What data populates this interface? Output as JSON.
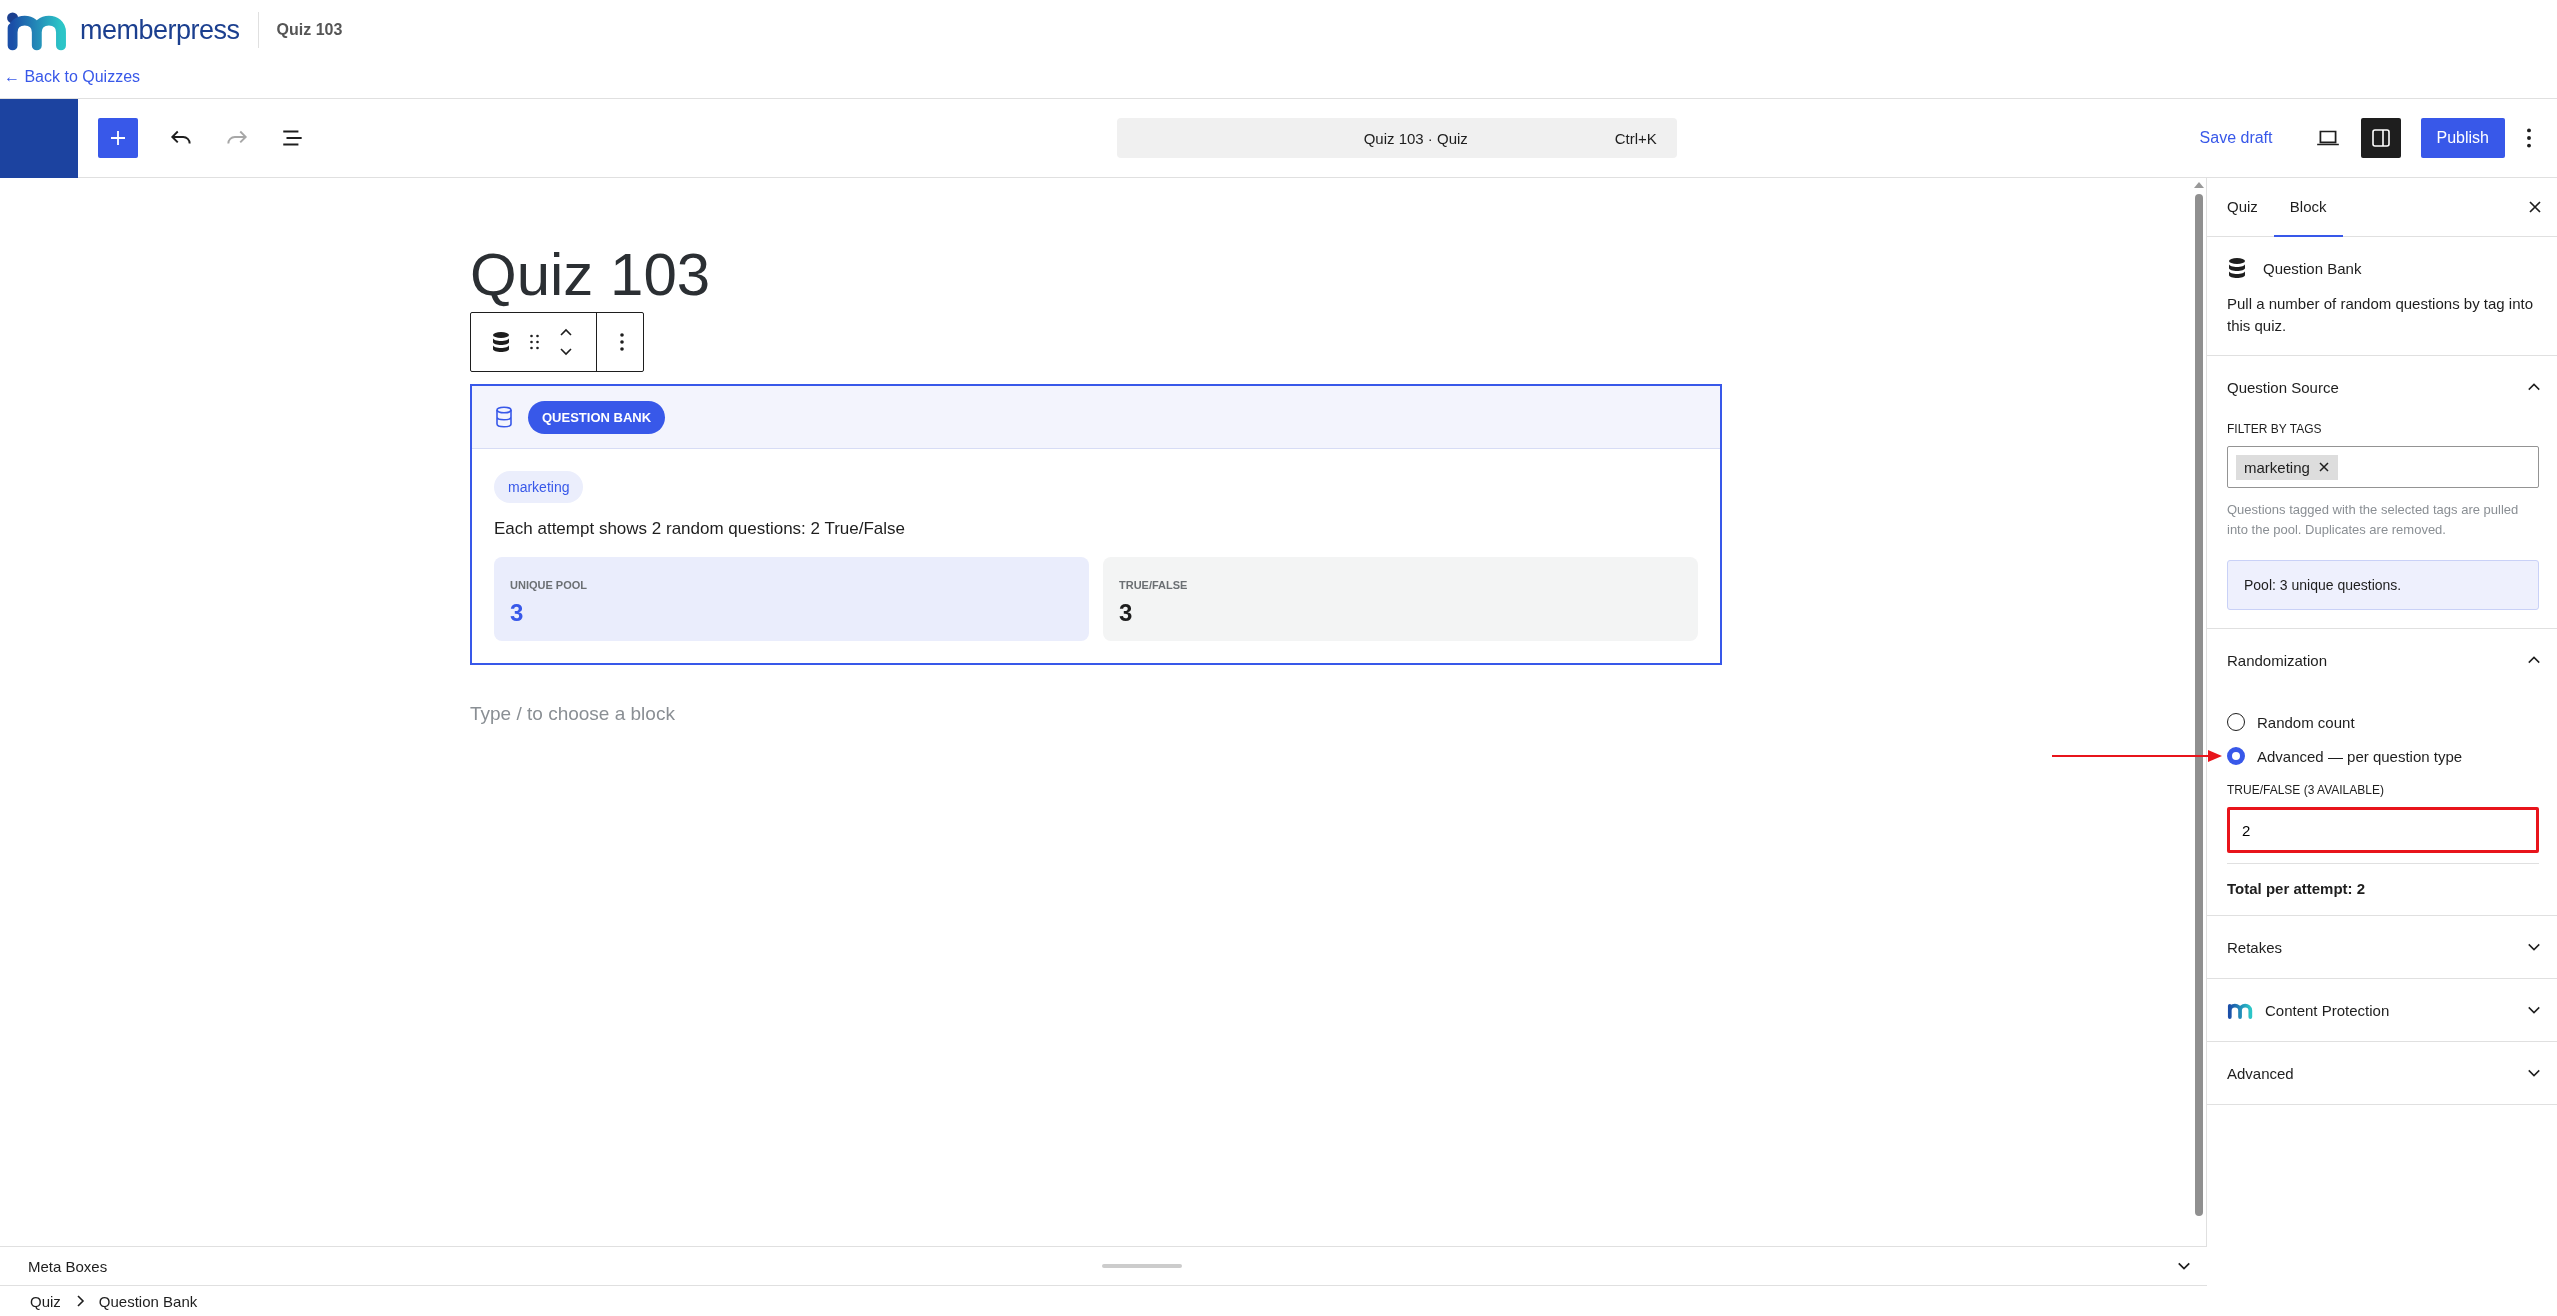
{
  "header": {
    "brand": "memberpress",
    "page_title": "Quiz 103",
    "back_link": "← Back to Quizzes"
  },
  "toolbar": {
    "command_title": "Quiz 103 · Quiz",
    "shortcut": "Ctrl+K",
    "save_draft": "Save draft",
    "publish": "Publish",
    "redo_disabled": true,
    "settings_open": true
  },
  "editor": {
    "title": "Quiz 103",
    "badge": "QUESTION BANK",
    "tag": "marketing",
    "summary": "Each attempt shows 2 random questions: 2 True/False",
    "stats": [
      {
        "label": "UNIQUE POOL",
        "value": "3",
        "kind": "pool"
      },
      {
        "label": "TRUE/FALSE",
        "value": "3",
        "kind": "type"
      }
    ],
    "placeholder": "Type / to choose a block"
  },
  "meta_boxes": {
    "label": "Meta Boxes",
    "expanded": false
  },
  "breadcrumb": [
    "Quiz",
    "Question Bank"
  ],
  "sidebar": {
    "tabs": [
      {
        "label": "Quiz",
        "selected": false
      },
      {
        "label": "Block",
        "selected": true
      }
    ],
    "block_name": "Question Bank",
    "block_description": "Pull a number of random questions by tag into this quiz.",
    "sections": [
      {
        "kind": "source",
        "title": "Question Source",
        "expanded": true,
        "filter_label": "FILTER BY TAGS",
        "tags": [
          "marketing"
        ],
        "help": "Questions tagged with the selected tags are pulled into the pool. Duplicates are removed.",
        "pool_note": "Pool: 3 unique questions."
      },
      {
        "kind": "randomization",
        "title": "Randomization",
        "expanded": true,
        "options": [
          {
            "label": "Random count",
            "selected": false,
            "pointed": false
          },
          {
            "label": "Advanced — per question type",
            "selected": true,
            "pointed": true
          }
        ],
        "field_label": "TRUE/FALSE (3 AVAILABLE)",
        "field_value": "2",
        "field_highlighted": true,
        "total": "Total per attempt: 2"
      },
      {
        "kind": "plain",
        "title": "Retakes",
        "expanded": false
      },
      {
        "kind": "brand",
        "title": "Content Protection",
        "expanded": false
      },
      {
        "kind": "plain",
        "title": "Advanced",
        "expanded": false
      }
    ]
  }
}
